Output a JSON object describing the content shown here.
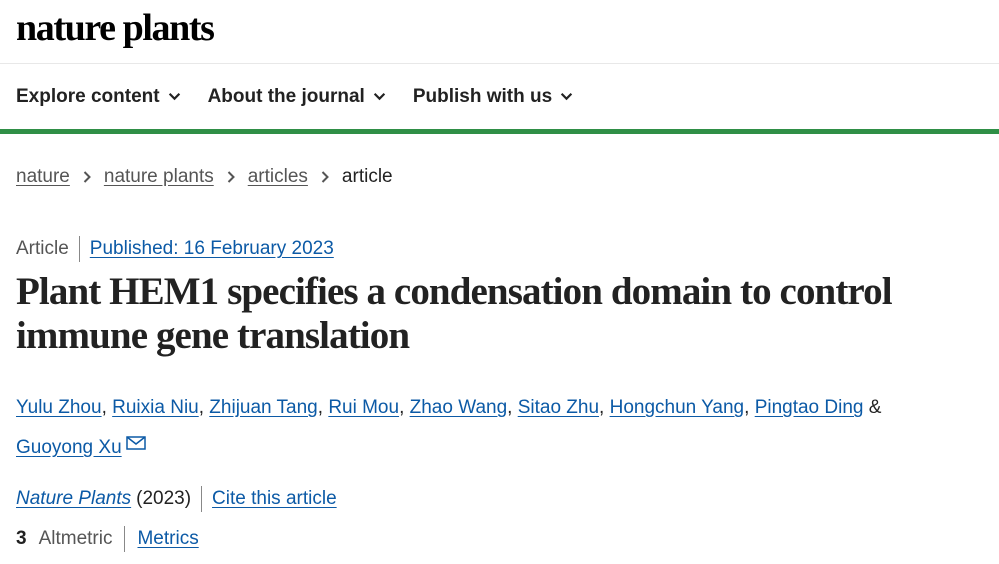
{
  "header": {
    "logo": "nature plants"
  },
  "nav": {
    "items": [
      {
        "label": "Explore content"
      },
      {
        "label": "About the journal"
      },
      {
        "label": "Publish with us"
      }
    ]
  },
  "breadcrumbs": {
    "items": [
      "nature",
      "nature plants",
      "articles"
    ],
    "current": "article"
  },
  "article": {
    "type": "Article",
    "published": "Published: 16 February 2023",
    "title": "Plant HEM1 specifies a condensation domain to control immune gene translation",
    "authors": [
      "Yulu Zhou",
      "Ruixia Niu",
      "Zhijuan Tang",
      "Rui Mou",
      "Zhao Wang",
      "Sitao Zhu",
      "Hongchun Yang",
      "Pingtao Ding",
      "Guoyong Xu"
    ],
    "authors_sep": ", ",
    "authors_last_sep": " & ",
    "journal": "Nature Plants",
    "year": "(2023)",
    "cite_label": "Cite this article",
    "altmetric_value": "3",
    "altmetric_label": "Altmetric",
    "metrics_label": "Metrics"
  },
  "colors": {
    "accent": "#2f8f46",
    "link": "#0c5aa6"
  },
  "icons": {
    "nav_chevron": "chevron-down-icon",
    "crumb_separator": "chevron-right-icon",
    "corresponding_author": "mail-icon"
  }
}
